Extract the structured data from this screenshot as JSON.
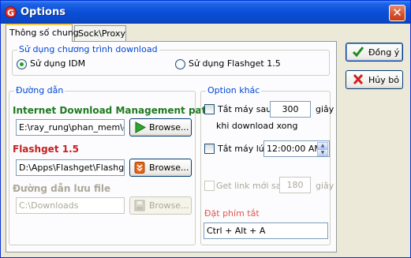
{
  "window": {
    "title": "Options",
    "app_icon_letter": "G",
    "close_symbol": "✕"
  },
  "tabs": [
    {
      "label": "Thông số chung",
      "active": true
    },
    {
      "label": "Sock\\Proxy",
      "active": false
    }
  ],
  "download_program": {
    "legend": "Sử dụng chương trình download",
    "options": [
      {
        "label": "Sử dụng IDM",
        "selected": true
      },
      {
        "label": "Sử dụng Flashget 1.5",
        "selected": false
      }
    ]
  },
  "paths": {
    "legend": "Đường dẫn",
    "idm_heading": "Internet Download Management path",
    "idm_value": "E:\\ray_rung\\phan_mem\\do",
    "flashget_heading": "Flashget 1.5",
    "flashget_value": "D:\\Apps\\Flashget\\Flashget",
    "save_heading": "Đường dẫn lưu file",
    "save_value": "C:\\Downloads",
    "browse_label": "Browse..."
  },
  "other_options": {
    "legend": "Option khác",
    "shutdown_after_label": "Tắt máy sau",
    "shutdown_after_value": "300",
    "shutdown_after_unit": "giây",
    "shutdown_after_note": "khi download xong",
    "shutdown_at_label": "Tắt máy lúc",
    "shutdown_at_value": "12:00:00 AM",
    "get_link_label": "Get link mới sau",
    "get_link_value": "180",
    "get_link_unit": "giây",
    "hotkey_heading": "Đặt phím tắt",
    "hotkey_value": "Ctrl + Alt + A"
  },
  "actions": {
    "ok_label": "Đồng ý",
    "cancel_label": "Hủy bỏ"
  },
  "colors": {
    "idm_heading": "#1f7a1f",
    "flashget_heading": "#c81e1e",
    "hotkey_heading": "#e0564e"
  }
}
